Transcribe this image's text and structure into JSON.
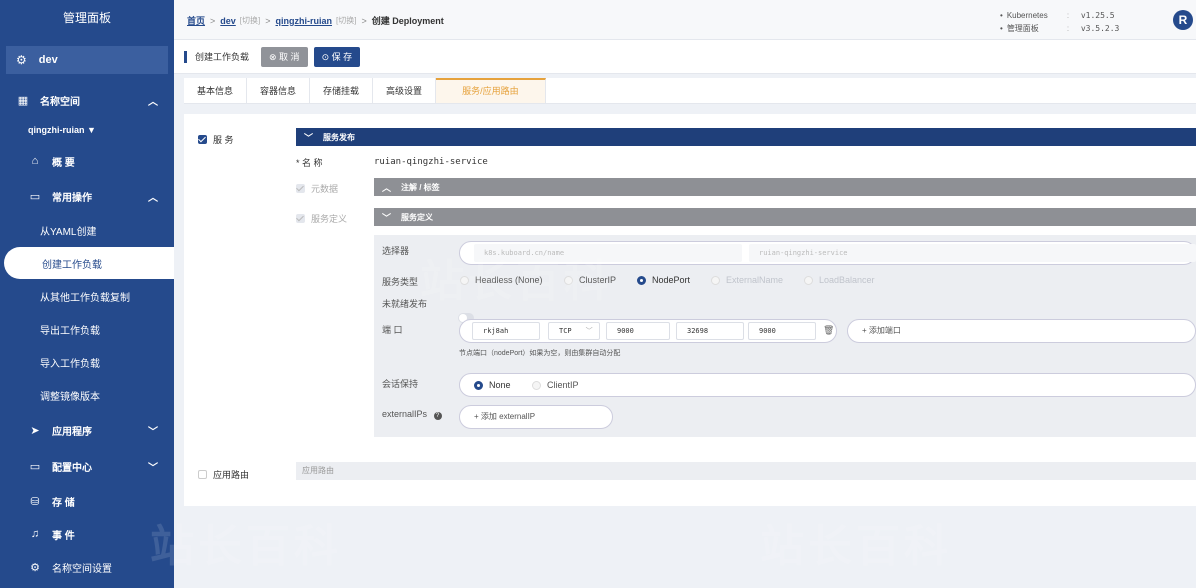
{
  "sidebar": {
    "title": "管理面板",
    "cluster": "dev",
    "items": [
      {
        "label": "名称空间"
      },
      {
        "label": "qingzhi-ruian ▼"
      },
      {
        "label": "概 要"
      },
      {
        "label": "常用操作"
      },
      {
        "label": "从YAML创建"
      },
      {
        "label": "创建工作负载"
      },
      {
        "label": "从其他工作负载复制"
      },
      {
        "label": "导出工作负载"
      },
      {
        "label": "导入工作负载"
      },
      {
        "label": "调整镜像版本"
      },
      {
        "label": "应用程序"
      },
      {
        "label": "配置中心"
      },
      {
        "label": "存 储"
      },
      {
        "label": "事 件"
      },
      {
        "label": "名称空间设置"
      }
    ]
  },
  "breadcrumb": {
    "home": "首页",
    "cluster": "dev",
    "cluster_tag": "[切换]",
    "namespace": "qingzhi-ruian",
    "namespace_tag": "[切换]",
    "current": "创建 Deployment"
  },
  "versions": {
    "k8s_label": "Kubernetes",
    "k8s_version": "v1.25.5",
    "kb_label": "管理面板",
    "kb_version": "v3.5.2.3",
    "colon": ":"
  },
  "logo": "R",
  "toolbar": {
    "title": "创建工作负载",
    "cancel": "⊗ 取 消",
    "save": "⊙ 保 存"
  },
  "tabs": [
    "基本信息",
    "容器信息",
    "存储挂载",
    "高级设置",
    "服务/应用路由"
  ],
  "service": {
    "checkbox_label": "服 务",
    "header": "服务发布",
    "name_label": "* 名 称",
    "name_value": "ruian-qingzhi-service",
    "metadata_label": "元数据",
    "annotations_header": "注解 / 标签",
    "svcdef_label": "服务定义",
    "svcdef_header": "服务定义",
    "selector_label": "选择器",
    "selector_key": "k8s.kuboard.cn/name",
    "selector_value": "ruian-qingzhi-service",
    "type_label": "服务类型",
    "types": [
      "Headless (None)",
      "ClusterIP",
      "NodePort",
      "ExternalName",
      "LoadBalancer"
    ],
    "selected_type": "NodePort",
    "unready_label": "未就绪发布",
    "port_label": "端 口",
    "port": {
      "name": "rkj8ah",
      "protocol": "TCP",
      "port": "9000",
      "node_port": "32698",
      "target_port": "9000"
    },
    "add_port": "+ 添加端口",
    "port_hint": "节点端口（nodePort）如果为空，则由集群自动分配",
    "session_label": "会话保持",
    "session_options": [
      "None",
      "ClientIP"
    ],
    "session_selected": "None",
    "externalips_label": "externalIPs",
    "add_externalip": "+ 添加 externalIP"
  },
  "route": {
    "checkbox_label": "应用路由",
    "header": "应用路由"
  },
  "watermark": "站长百科"
}
